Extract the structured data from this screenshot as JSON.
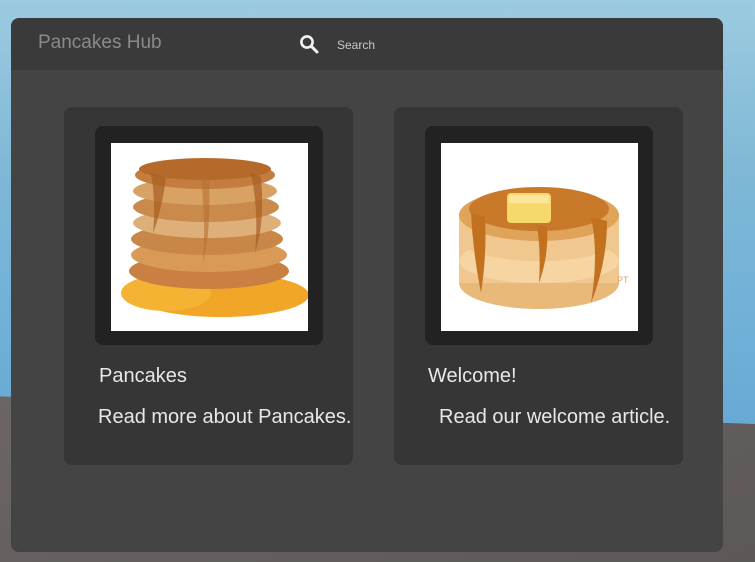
{
  "app": {
    "title": "Pancakes Hub"
  },
  "search": {
    "placeholder": "Search",
    "icon": "search-icon"
  },
  "cards": [
    {
      "title": "Pancakes",
      "description": "Read more about Pancakes.",
      "image": "pancake-stack-syrup"
    },
    {
      "title": "Welcome!",
      "description": "Read our welcome article.",
      "image": "pixel-pancake-butter"
    }
  ],
  "colors": {
    "panel": "#444444",
    "topbar": "#3a3a3a",
    "card": "#363636",
    "thumb_frame": "#222222",
    "text": "#e8e8e8"
  }
}
